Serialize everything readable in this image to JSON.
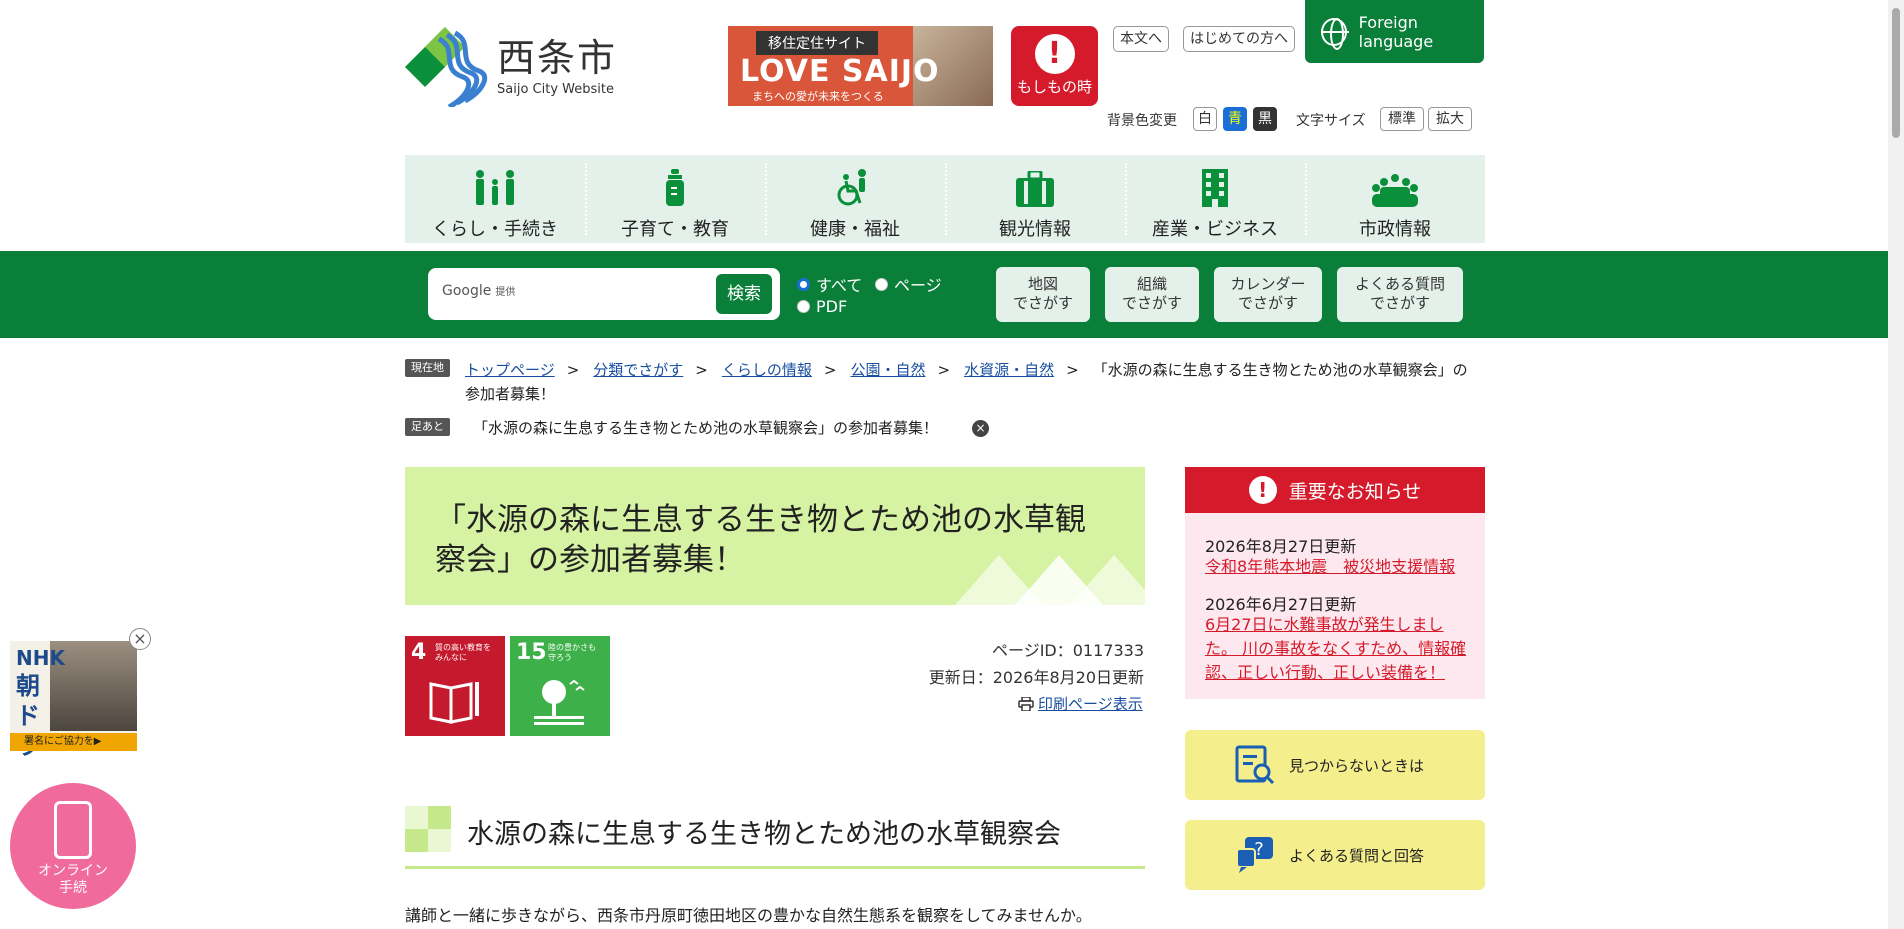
{
  "header": {
    "site_name": "西条市",
    "site_name_en": "Saijo City Website",
    "banner": {
      "top": "移住定住サイト",
      "main": "LOVE SAIJO",
      "sub": "まちへの愛が未来をつくる"
    },
    "emergency": "もしもの時",
    "links": {
      "main_text": "本文へ",
      "first_time": "はじめての方へ"
    },
    "foreign": "Foreign language",
    "bg_label": "背景色変更",
    "bg_options": [
      "白",
      "青",
      "黒"
    ],
    "font_label": "文字サイズ",
    "font_options": [
      "標準",
      "拡大"
    ]
  },
  "nav": {
    "items": [
      "くらし・手続き",
      "子育て・教育",
      "健康・福祉",
      "観光情報",
      "産業・ビジネス",
      "市政情報"
    ]
  },
  "search": {
    "google": "Google",
    "provided": "提供",
    "button": "検索",
    "options": [
      "すべて",
      "ページ",
      "PDF"
    ]
  },
  "quick": [
    {
      "l1": "地図",
      "l2": "でさがす"
    },
    {
      "l1": "組織",
      "l2": "でさがす"
    },
    {
      "l1": "カレンダー",
      "l2": "でさがす"
    },
    {
      "l1": "よくある質問",
      "l2": "でさがす"
    }
  ],
  "breadcrumb": {
    "label": "現在地",
    "items": [
      "トップページ",
      "分類でさがす",
      "くらしの情報",
      "公園・自然",
      "水資源・自然"
    ],
    "separator": ">",
    "current": "「水源の森に生息する生き物とため池の水草観察会」の参加者募集！"
  },
  "footprint": {
    "label": "足あと",
    "item": "「水源の森に生息する生き物とため池の水草観察会」の参加者募集！",
    "close": "×"
  },
  "page": {
    "title": "「水源の森に生息する生き物とため池の水草観察会」の参加者募集！",
    "sdgs": [
      {
        "num": "4",
        "text": "質の高い教育を みんなに",
        "color": "#c5192d"
      },
      {
        "num": "15",
        "text": "陸の豊かさも 守ろう",
        "color": "#3eb049"
      }
    ],
    "page_id": "ページID：0117333",
    "updated": "更新日：2026年8月20日更新",
    "print": "印刷ページ表示",
    "heading": "水源の森に生息する生き物とため池の水草観察会",
    "lead": "講師と一緒に歩きながら、西条市丹原町徳田地区の豊かな自然生態系を観察をしてみませんか。"
  },
  "notice": {
    "title": "重要なお知らせ",
    "items": [
      {
        "date": "2026年8月27日更新",
        "text": "令和8年熊本地震　被災地支援情報"
      },
      {
        "date": "2026年6月27日更新",
        "text": "6月27日に水難事故が発生しました。 川の事故をなくすため、情報確認、正しい行動、正しい装備を！"
      }
    ]
  },
  "side": {
    "not_found": "見つからないときは",
    "faq": "よくある質問と回答"
  },
  "floating": {
    "nhk_top": "NHK",
    "nhk_main": "朝ドラ",
    "nhk_bar": "署名にご協力を▶",
    "close": "×",
    "online": [
      "オンライン",
      "手続"
    ]
  }
}
